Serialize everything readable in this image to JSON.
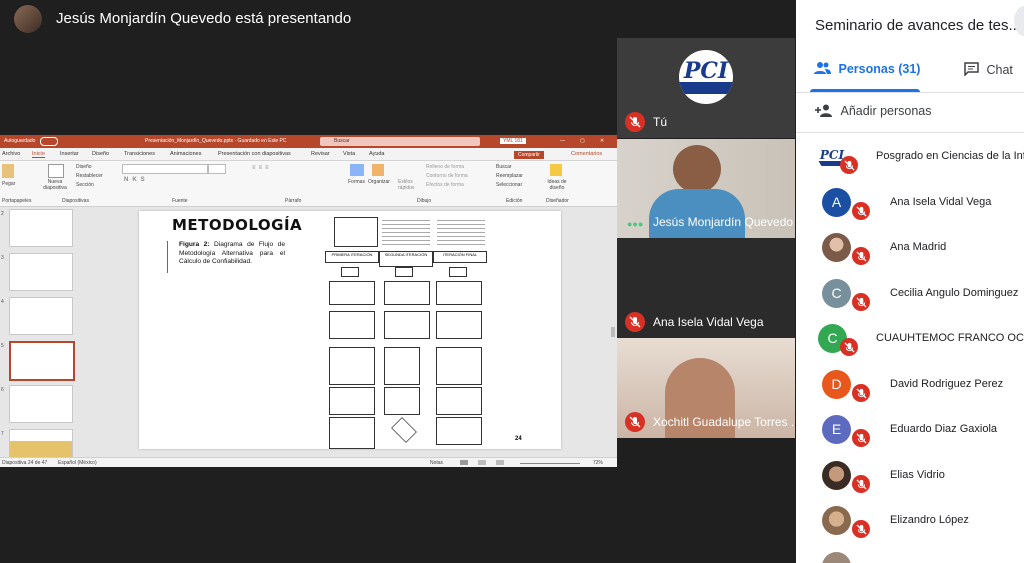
{
  "header": {
    "presenter_status": "Jesús Monjardín Quevedo está presentando"
  },
  "ppt": {
    "autosave": "Autoguardado",
    "file_title": "Presentación_Monjardín_Quevedo.pptx  ·  Guardado en Este PC",
    "search_placeholder": "Buscar",
    "user_tag": "YML 181",
    "tabs": [
      "Archivo",
      "Inicio",
      "Insertar",
      "Diseño",
      "Transiciones",
      "Animaciones",
      "Presentación con diapositivas",
      "Revisar",
      "Vista",
      "Ayuda"
    ],
    "share": "Compartir",
    "comments": "Comentarios",
    "ribbon_groups": [
      "Portapapeles",
      "Diapositivas",
      "Fuente",
      "Párrafo",
      "Dibujo",
      "Edición",
      "Diseñador"
    ],
    "ribbon_tools": {
      "paste": "Pegar",
      "new_slide": "Nueva diapositiva",
      "layout": "Diseño",
      "reset": "Restablecer",
      "section": "Sección",
      "shapes": "Formas",
      "arrange": "Organizar",
      "quick_styles": "Estilos rápidos",
      "fill": "Relleno de forma",
      "outline": "Contorno de forma",
      "effects": "Efectos de forma",
      "find": "Buscar",
      "replace": "Reemplazar",
      "select": "Seleccionar",
      "ideas": "Ideas de diseño"
    },
    "slide": {
      "heading": "METODOLOGÍA",
      "caption_bold": "Figura 2:",
      "caption_text": "Diagrama de Flujo de Metodología Alternativa para el Cálculo de Confiabilidad.",
      "page_number": "24",
      "flow_headers": [
        "PRIMERA ITERACIÓN",
        "SEGUNDA ITERACIÓN",
        "ITERACIÓN FINAL"
      ]
    },
    "thumb_numbers": [
      "2",
      "3",
      "4",
      "5",
      "6",
      "7"
    ],
    "status": {
      "slide_count": "Diapositiva 24 de 47",
      "language": "Español (México)",
      "notes": "Notas",
      "zoom": "72%"
    }
  },
  "tiles": [
    {
      "name": "Tú"
    },
    {
      "name": "Jesús Monjardín Quevedo"
    },
    {
      "name": "Ana Isela Vidal Vega"
    },
    {
      "name": "Xochitl Guadalupe Torres ..."
    }
  ],
  "panel": {
    "title": "Seminario de avances de tes...",
    "tab_people": "Personas (31)",
    "tab_chat": "Chat",
    "add_people": "Añadir personas",
    "people": [
      {
        "initial": "",
        "name": "Posgrado en Ciencias de la Inf...",
        "color": "#ffffff",
        "type": "logo"
      },
      {
        "initial": "A",
        "name": "Ana Isela Vidal Vega",
        "color": "#1a4fa3",
        "type": "letter"
      },
      {
        "initial": "",
        "name": "Ana Madrid",
        "color": "#c9a08a",
        "type": "photo"
      },
      {
        "initial": "C",
        "name": "Cecilia Angulo Dominguez",
        "color": "#78909c",
        "type": "letter"
      },
      {
        "initial": "C",
        "name": "CUAUHTEMOC FRANCO OCHOA",
        "color": "#33a852",
        "type": "letter"
      },
      {
        "initial": "D",
        "name": "David Rodriguez Perez",
        "color": "#e8581c",
        "type": "letter"
      },
      {
        "initial": "E",
        "name": "Eduardo Diaz Gaxiola",
        "color": "#5c6bc0",
        "type": "letter"
      },
      {
        "initial": "",
        "name": "Elias Vidrio",
        "color": "#7a5a45",
        "type": "photo"
      },
      {
        "initial": "",
        "name": "Elizandro López",
        "color": "#a88060",
        "type": "photo"
      }
    ]
  }
}
